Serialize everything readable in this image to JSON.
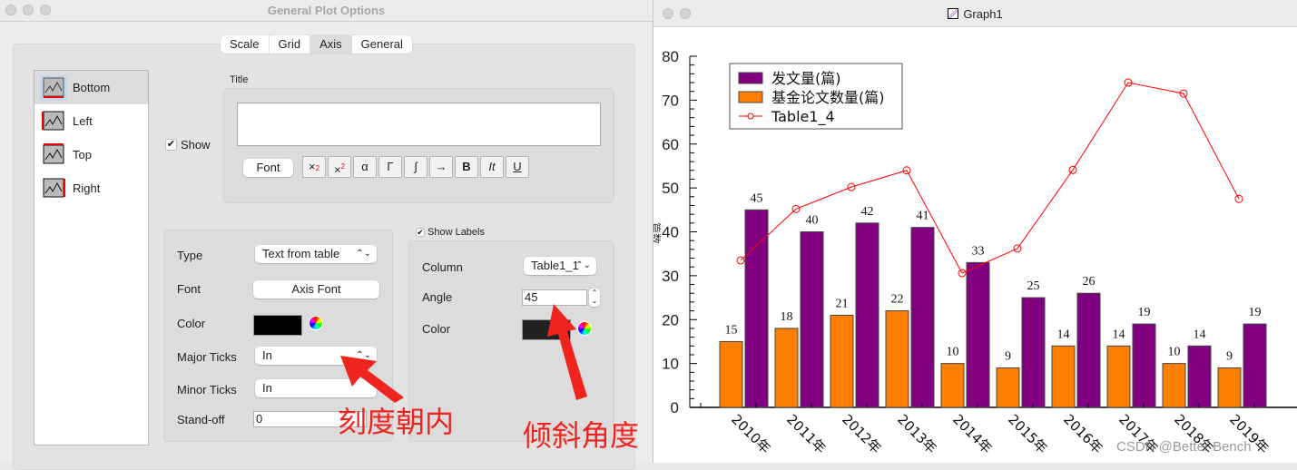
{
  "dialog": {
    "title": "General Plot Options",
    "tabs": [
      {
        "label": "Scale",
        "active": false
      },
      {
        "label": "Grid",
        "active": false
      },
      {
        "label": "Axis",
        "active": true
      },
      {
        "label": "General",
        "active": false
      }
    ],
    "axes": [
      {
        "label": "Bottom",
        "selected": true
      },
      {
        "label": "Left",
        "selected": false
      },
      {
        "label": "Top",
        "selected": false
      },
      {
        "label": "Right",
        "selected": false
      }
    ],
    "show_label": "Show",
    "show_checked": true,
    "title_label": "Title",
    "title_value": "",
    "font_button": "Font",
    "format_buttons": [
      {
        "name": "subscript",
        "label": "x₂"
      },
      {
        "name": "superscript",
        "label": "x²"
      },
      {
        "name": "alpha",
        "label": "α"
      },
      {
        "name": "gamma",
        "label": "Γ"
      },
      {
        "name": "integral",
        "label": "∫"
      },
      {
        "name": "arrow",
        "label": "→"
      },
      {
        "name": "bold",
        "label": "B"
      },
      {
        "name": "italic",
        "label": "It"
      },
      {
        "name": "underline",
        "label": "U"
      }
    ],
    "axis_settings": {
      "type_label": "Type",
      "type_value": "Text from table",
      "font_label": "Font",
      "font_button": "Axis Font",
      "color_label": "Color",
      "color_value": "#000000",
      "major_ticks_label": "Major Ticks",
      "major_ticks_value": "In",
      "minor_ticks_label": "Minor Ticks",
      "minor_ticks_value": "In",
      "standoff_label": "Stand-off",
      "standoff_value": "0"
    },
    "labels_settings": {
      "show_labels": "Show Labels",
      "show_labels_checked": true,
      "column_label": "Column",
      "column_value": "Table1_1",
      "angle_label": "Angle",
      "angle_value": "45",
      "color_label": "Color",
      "color_value": "#222222"
    },
    "annotations": {
      "ticks_inward": "刻度朝内",
      "tilt_angle": "倾斜角度",
      "color": "#f0241f"
    }
  },
  "graph_window": {
    "title": "Graph1",
    "watermark": "CSDN @Better Bench"
  },
  "chart_data": {
    "type": "bar",
    "title": "",
    "xlabel": "",
    "ylabel": "篇数",
    "ylim": [
      0,
      80
    ],
    "yticks": [
      0,
      10,
      20,
      30,
      40,
      50,
      60,
      70,
      80
    ],
    "categories": [
      "2010年",
      "2011年",
      "2012年",
      "2013年",
      "2014年",
      "2015年",
      "2016年",
      "2017年",
      "2018年",
      "2019年"
    ],
    "x_label_angle": 45,
    "grid": false,
    "legend_position": "top-left",
    "series": [
      {
        "name": "基金论文数量(篇)",
        "type": "bar",
        "color": "#ff8000",
        "values": [
          15,
          18,
          21,
          22,
          10,
          9,
          14,
          14,
          10,
          9
        ],
        "data_labels": true
      },
      {
        "name": "发文量(篇)",
        "type": "bar",
        "color": "#800080",
        "values": [
          45,
          40,
          42,
          41,
          33,
          25,
          26,
          19,
          14,
          19
        ],
        "data_labels": true
      },
      {
        "name": "Table1_4",
        "type": "line",
        "color": "#ff0000",
        "marker": "circle",
        "values": [
          33.5,
          45.2,
          50.2,
          54,
          30.6,
          36.2,
          54.1,
          74,
          71.5,
          47.5
        ],
        "data_labels": false
      }
    ],
    "legend_order": [
      "发文量(篇)",
      "基金论文数量(篇)",
      "Table1_4"
    ]
  }
}
